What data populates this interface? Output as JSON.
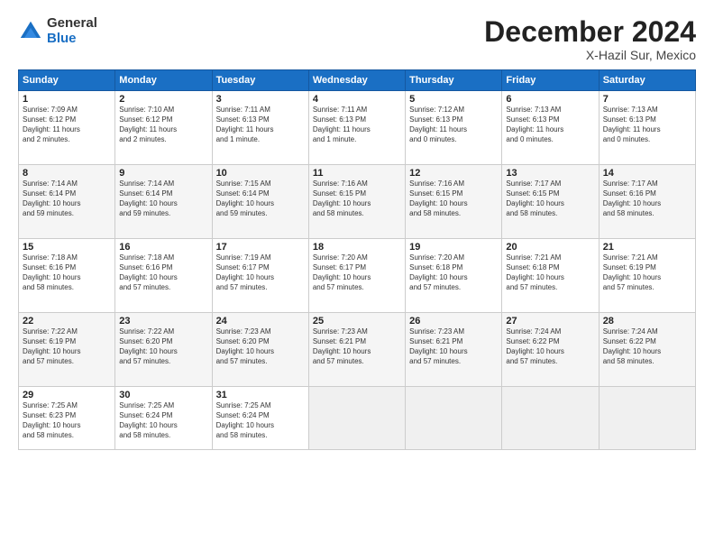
{
  "logo": {
    "general": "General",
    "blue": "Blue"
  },
  "title": "December 2024",
  "location": "X-Hazil Sur, Mexico",
  "weekdays": [
    "Sunday",
    "Monday",
    "Tuesday",
    "Wednesday",
    "Thursday",
    "Friday",
    "Saturday"
  ],
  "weeks": [
    [
      {
        "day": "1",
        "info": "Sunrise: 7:09 AM\nSunset: 6:12 PM\nDaylight: 11 hours\nand 2 minutes."
      },
      {
        "day": "2",
        "info": "Sunrise: 7:10 AM\nSunset: 6:12 PM\nDaylight: 11 hours\nand 2 minutes."
      },
      {
        "day": "3",
        "info": "Sunrise: 7:11 AM\nSunset: 6:13 PM\nDaylight: 11 hours\nand 1 minute."
      },
      {
        "day": "4",
        "info": "Sunrise: 7:11 AM\nSunset: 6:13 PM\nDaylight: 11 hours\nand 1 minute."
      },
      {
        "day": "5",
        "info": "Sunrise: 7:12 AM\nSunset: 6:13 PM\nDaylight: 11 hours\nand 0 minutes."
      },
      {
        "day": "6",
        "info": "Sunrise: 7:13 AM\nSunset: 6:13 PM\nDaylight: 11 hours\nand 0 minutes."
      },
      {
        "day": "7",
        "info": "Sunrise: 7:13 AM\nSunset: 6:13 PM\nDaylight: 11 hours\nand 0 minutes."
      }
    ],
    [
      {
        "day": "8",
        "info": "Sunrise: 7:14 AM\nSunset: 6:14 PM\nDaylight: 10 hours\nand 59 minutes."
      },
      {
        "day": "9",
        "info": "Sunrise: 7:14 AM\nSunset: 6:14 PM\nDaylight: 10 hours\nand 59 minutes."
      },
      {
        "day": "10",
        "info": "Sunrise: 7:15 AM\nSunset: 6:14 PM\nDaylight: 10 hours\nand 59 minutes."
      },
      {
        "day": "11",
        "info": "Sunrise: 7:16 AM\nSunset: 6:15 PM\nDaylight: 10 hours\nand 58 minutes."
      },
      {
        "day": "12",
        "info": "Sunrise: 7:16 AM\nSunset: 6:15 PM\nDaylight: 10 hours\nand 58 minutes."
      },
      {
        "day": "13",
        "info": "Sunrise: 7:17 AM\nSunset: 6:15 PM\nDaylight: 10 hours\nand 58 minutes."
      },
      {
        "day": "14",
        "info": "Sunrise: 7:17 AM\nSunset: 6:16 PM\nDaylight: 10 hours\nand 58 minutes."
      }
    ],
    [
      {
        "day": "15",
        "info": "Sunrise: 7:18 AM\nSunset: 6:16 PM\nDaylight: 10 hours\nand 58 minutes."
      },
      {
        "day": "16",
        "info": "Sunrise: 7:18 AM\nSunset: 6:16 PM\nDaylight: 10 hours\nand 57 minutes."
      },
      {
        "day": "17",
        "info": "Sunrise: 7:19 AM\nSunset: 6:17 PM\nDaylight: 10 hours\nand 57 minutes."
      },
      {
        "day": "18",
        "info": "Sunrise: 7:20 AM\nSunset: 6:17 PM\nDaylight: 10 hours\nand 57 minutes."
      },
      {
        "day": "19",
        "info": "Sunrise: 7:20 AM\nSunset: 6:18 PM\nDaylight: 10 hours\nand 57 minutes."
      },
      {
        "day": "20",
        "info": "Sunrise: 7:21 AM\nSunset: 6:18 PM\nDaylight: 10 hours\nand 57 minutes."
      },
      {
        "day": "21",
        "info": "Sunrise: 7:21 AM\nSunset: 6:19 PM\nDaylight: 10 hours\nand 57 minutes."
      }
    ],
    [
      {
        "day": "22",
        "info": "Sunrise: 7:22 AM\nSunset: 6:19 PM\nDaylight: 10 hours\nand 57 minutes."
      },
      {
        "day": "23",
        "info": "Sunrise: 7:22 AM\nSunset: 6:20 PM\nDaylight: 10 hours\nand 57 minutes."
      },
      {
        "day": "24",
        "info": "Sunrise: 7:23 AM\nSunset: 6:20 PM\nDaylight: 10 hours\nand 57 minutes."
      },
      {
        "day": "25",
        "info": "Sunrise: 7:23 AM\nSunset: 6:21 PM\nDaylight: 10 hours\nand 57 minutes."
      },
      {
        "day": "26",
        "info": "Sunrise: 7:23 AM\nSunset: 6:21 PM\nDaylight: 10 hours\nand 57 minutes."
      },
      {
        "day": "27",
        "info": "Sunrise: 7:24 AM\nSunset: 6:22 PM\nDaylight: 10 hours\nand 57 minutes."
      },
      {
        "day": "28",
        "info": "Sunrise: 7:24 AM\nSunset: 6:22 PM\nDaylight: 10 hours\nand 58 minutes."
      }
    ],
    [
      {
        "day": "29",
        "info": "Sunrise: 7:25 AM\nSunset: 6:23 PM\nDaylight: 10 hours\nand 58 minutes."
      },
      {
        "day": "30",
        "info": "Sunrise: 7:25 AM\nSunset: 6:24 PM\nDaylight: 10 hours\nand 58 minutes."
      },
      {
        "day": "31",
        "info": "Sunrise: 7:25 AM\nSunset: 6:24 PM\nDaylight: 10 hours\nand 58 minutes."
      },
      {
        "day": "",
        "info": ""
      },
      {
        "day": "",
        "info": ""
      },
      {
        "day": "",
        "info": ""
      },
      {
        "day": "",
        "info": ""
      }
    ]
  ]
}
